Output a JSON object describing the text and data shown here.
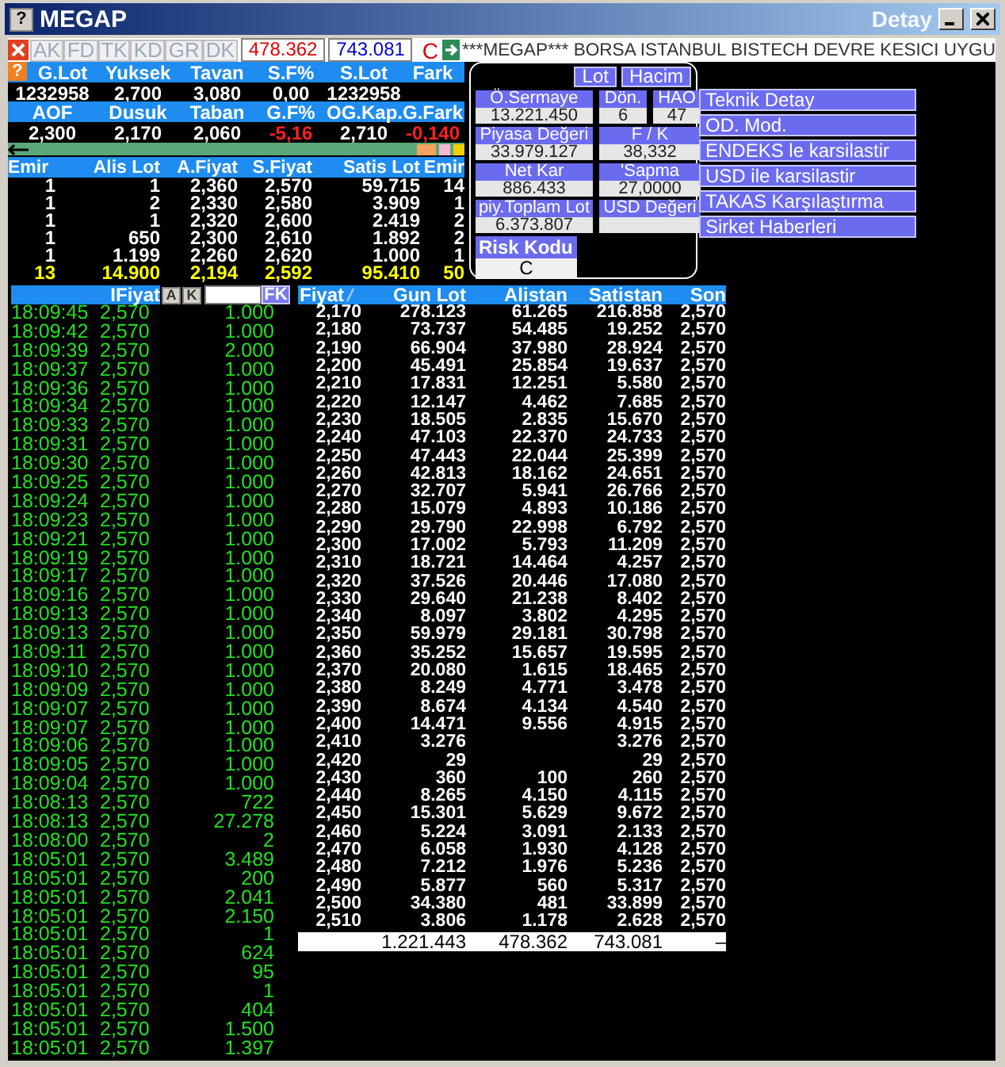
{
  "window": {
    "help_label": "?",
    "title": "MEGAP",
    "title_right": "Detay"
  },
  "stats_help_label": "?",
  "toolbar": {
    "buttons": [
      "AK",
      "FD",
      "TK",
      "KD",
      "GR",
      "DK"
    ],
    "figures": [
      {
        "text": "478.362",
        "color": "#e00000"
      },
      {
        "text": "743.081",
        "color": "#0000d0"
      }
    ],
    "status": "C",
    "ticker": "***MEGAP*** BORSA ISTANBUL BISTECH DEVRE KESICI UYGU"
  },
  "stats": [
    {
      "headers": [
        "G.Lot",
        "Yuksek",
        "Tavan",
        "S.F%",
        "S.Lot",
        "Fark"
      ],
      "values": [
        {
          "text": "1232958",
          "negative": false
        },
        {
          "text": "2,700",
          "negative": false
        },
        {
          "text": "3,080",
          "negative": false
        },
        {
          "text": "0,00",
          "negative": false
        },
        {
          "text": "1232958",
          "negative": false
        }
      ]
    },
    {
      "headers": [
        "AOF",
        "Dusuk",
        "Taban",
        "G.F%",
        "OG.Kap.",
        "G.Fark"
      ],
      "values": [
        {
          "text": "2,300",
          "negative": false
        },
        {
          "text": "2,170",
          "negative": false
        },
        {
          "text": "2,060",
          "negative": false
        },
        {
          "text": "-5,16",
          "negative": true
        },
        {
          "text": "2,710",
          "negative": false
        },
        {
          "text": "-0,140",
          "negative": true
        }
      ]
    }
  ],
  "orderbook": {
    "columns": [
      "Emir",
      "Alis Lot",
      "A.Fiyat",
      "S.Fiyat",
      "Satis Lot",
      "Emir"
    ],
    "rows": [
      [
        "1",
        "1",
        "2,360",
        "2,570",
        "59.715",
        "14"
      ],
      [
        "1",
        "2",
        "2,330",
        "2,580",
        "3.909",
        "1"
      ],
      [
        "1",
        "1",
        "2,320",
        "2,600",
        "2.419",
        "2"
      ],
      [
        "1",
        "650",
        "2,300",
        "2,610",
        "1.892",
        "2"
      ],
      [
        "1",
        "1.199",
        "2,260",
        "2,620",
        "1.000",
        "1"
      ]
    ],
    "total": [
      "13",
      "14.900",
      "2,194",
      "2,592",
      "95.410",
      "50"
    ]
  },
  "detail": {
    "buttons": [
      "Lot",
      "Hacim"
    ],
    "fields": [
      {
        "label": "Ö.Sermaye",
        "value": "13.221.450"
      },
      {
        "label": "Dön.",
        "value": "6"
      },
      {
        "label": "HAO",
        "value": "47"
      },
      {
        "label": "Piyasa Değeri",
        "value": "33.979.127"
      },
      {
        "label": "F / K",
        "value": "38,332"
      },
      {
        "label": "Net Kar",
        "value": "886.433"
      },
      {
        "label": "'Sapma",
        "value": "27,0000"
      },
      {
        "label": "piy.Toplam Lot",
        "value": "6.373.807"
      },
      {
        "label": "USD Değeri"
      }
    ],
    "risk": {
      "label": "Risk Kodu",
      "value": "C"
    }
  },
  "menu": [
    "Teknik Detay",
    "OD. Mod.",
    "ENDEKS le karsilastir",
    "USD ile karsilastir",
    "TAKAS Karşılaştırma",
    "Sirket Haberleri"
  ],
  "trades": {
    "header": "IFiyat",
    "buttons": [
      "A",
      "K"
    ],
    "filter_button": "FK",
    "rows": [
      [
        "18:09:45",
        "2,570",
        "1.000"
      ],
      [
        "18:09:42",
        "2,570",
        "1.000"
      ],
      [
        "18:09:39",
        "2,570",
        "2.000"
      ],
      [
        "18:09:37",
        "2,570",
        "1.000"
      ],
      [
        "18:09:36",
        "2,570",
        "1.000"
      ],
      [
        "18:09:34",
        "2,570",
        "1.000"
      ],
      [
        "18:09:33",
        "2,570",
        "1.000"
      ],
      [
        "18:09:31",
        "2,570",
        "1.000"
      ],
      [
        "18:09:30",
        "2,570",
        "1.000"
      ],
      [
        "18:09:25",
        "2,570",
        "1.000"
      ],
      [
        "18:09:24",
        "2,570",
        "1.000"
      ],
      [
        "18:09:23",
        "2,570",
        "1.000"
      ],
      [
        "18:09:21",
        "2,570",
        "1.000"
      ],
      [
        "18:09:19",
        "2,570",
        "1.000"
      ],
      [
        "18:09:17",
        "2,570",
        "1.000"
      ],
      [
        "18:09:16",
        "2,570",
        "1.000"
      ],
      [
        "18:09:13",
        "2,570",
        "1.000"
      ],
      [
        "18:09:13",
        "2,570",
        "1.000"
      ],
      [
        "18:09:11",
        "2,570",
        "1.000"
      ],
      [
        "18:09:10",
        "2,570",
        "1.000"
      ],
      [
        "18:09:09",
        "2,570",
        "1.000"
      ],
      [
        "18:09:07",
        "2,570",
        "1.000"
      ],
      [
        "18:09:07",
        "2,570",
        "1.000"
      ],
      [
        "18:09:06",
        "2,570",
        "1.000"
      ],
      [
        "18:09:05",
        "2,570",
        "1.000"
      ],
      [
        "18:09:04",
        "2,570",
        "1.000"
      ],
      [
        "18:08:13",
        "2,570",
        "722"
      ],
      [
        "18:08:13",
        "2,570",
        "27.278"
      ],
      [
        "18:08:00",
        "2,570",
        "2"
      ],
      [
        "18:05:01",
        "2,570",
        "3.489"
      ],
      [
        "18:05:01",
        "2,570",
        "200"
      ],
      [
        "18:05:01",
        "2,570",
        "2.041"
      ],
      [
        "18:05:01",
        "2,570",
        "2.150"
      ],
      [
        "18:05:01",
        "2,570",
        "1"
      ],
      [
        "18:05:01",
        "2,570",
        "624"
      ],
      [
        "18:05:01",
        "2,570",
        "95"
      ],
      [
        "18:05:01",
        "2,570",
        "1"
      ],
      [
        "18:05:01",
        "2,570",
        "404"
      ],
      [
        "18:05:01",
        "2,570",
        "1.500"
      ],
      [
        "18:05:01",
        "2,570",
        "1.397"
      ]
    ]
  },
  "prices": {
    "columns": [
      "Fiyat",
      "Gun Lot",
      "Alistan",
      "Satistan",
      "Son"
    ],
    "rows": [
      [
        "2,170",
        "278.123",
        "61.265",
        "216.858",
        "2,570"
      ],
      [
        "2,180",
        "73.737",
        "54.485",
        "19.252",
        "2,570"
      ],
      [
        "2,190",
        "66.904",
        "37.980",
        "28.924",
        "2,570"
      ],
      [
        "2,200",
        "45.491",
        "25.854",
        "19.637",
        "2,570"
      ],
      [
        "2,210",
        "17.831",
        "12.251",
        "5.580",
        "2,570"
      ],
      [
        "2,220",
        "12.147",
        "4.462",
        "7.685",
        "2,570"
      ],
      [
        "2,230",
        "18.505",
        "2.835",
        "15.670",
        "2,570"
      ],
      [
        "2,240",
        "47.103",
        "22.370",
        "24.733",
        "2,570"
      ],
      [
        "2,250",
        "47.443",
        "22.044",
        "25.399",
        "2,570"
      ],
      [
        "2,260",
        "42.813",
        "18.162",
        "24.651",
        "2,570"
      ],
      [
        "2,270",
        "32.707",
        "5.941",
        "26.766",
        "2,570"
      ],
      [
        "2,280",
        "15.079",
        "4.893",
        "10.186",
        "2,570"
      ],
      [
        "2,290",
        "29.790",
        "22.998",
        "6.792",
        "2,570"
      ],
      [
        "2,300",
        "17.002",
        "5.793",
        "11.209",
        "2,570"
      ],
      [
        "2,310",
        "18.721",
        "14.464",
        "4.257",
        "2,570"
      ],
      [
        "2,320",
        "37.526",
        "20.446",
        "17.080",
        "2,570"
      ],
      [
        "2,330",
        "29.640",
        "21.238",
        "8.402",
        "2,570"
      ],
      [
        "2,340",
        "8.097",
        "3.802",
        "4.295",
        "2,570"
      ],
      [
        "2,350",
        "59.979",
        "29.181",
        "30.798",
        "2,570"
      ],
      [
        "2,360",
        "35.252",
        "15.657",
        "19.595",
        "2,570"
      ],
      [
        "2,370",
        "20.080",
        "1.615",
        "18.465",
        "2,570"
      ],
      [
        "2,380",
        "8.249",
        "4.771",
        "3.478",
        "2,570"
      ],
      [
        "2,390",
        "8.674",
        "4.134",
        "4.540",
        "2,570"
      ],
      [
        "2,400",
        "14.471",
        "9.556",
        "4.915",
        "2,570"
      ],
      [
        "2,410",
        "3.276",
        null,
        "3.276",
        "2,570"
      ],
      [
        "2,420",
        "29",
        null,
        "29",
        "2,570"
      ],
      [
        "2,430",
        "360",
        "100",
        "260",
        "2,570"
      ],
      [
        "2,440",
        "8.265",
        "4.150",
        "4.115",
        "2,570"
      ],
      [
        "2,450",
        "15.301",
        "5.629",
        "9.672",
        "2,570"
      ],
      [
        "2,460",
        "5.224",
        "3.091",
        "2.133",
        "2,570"
      ],
      [
        "2,470",
        "6.058",
        "1.930",
        "4.128",
        "2,570"
      ],
      [
        "2,480",
        "7.212",
        "1.976",
        "5.236",
        "2,570"
      ],
      [
        "2,490",
        "5.877",
        "560",
        "5.317",
        "2,570"
      ],
      [
        "2,500",
        "34.380",
        "481",
        "33.899",
        "2,570"
      ],
      [
        "2,510",
        "3.806",
        "1.178",
        "2.628",
        "2,570"
      ]
    ],
    "total": {
      "gun_lot": "1.221.443",
      "alistan": "478.362",
      "satistan": "743.081",
      "son": "–"
    }
  }
}
